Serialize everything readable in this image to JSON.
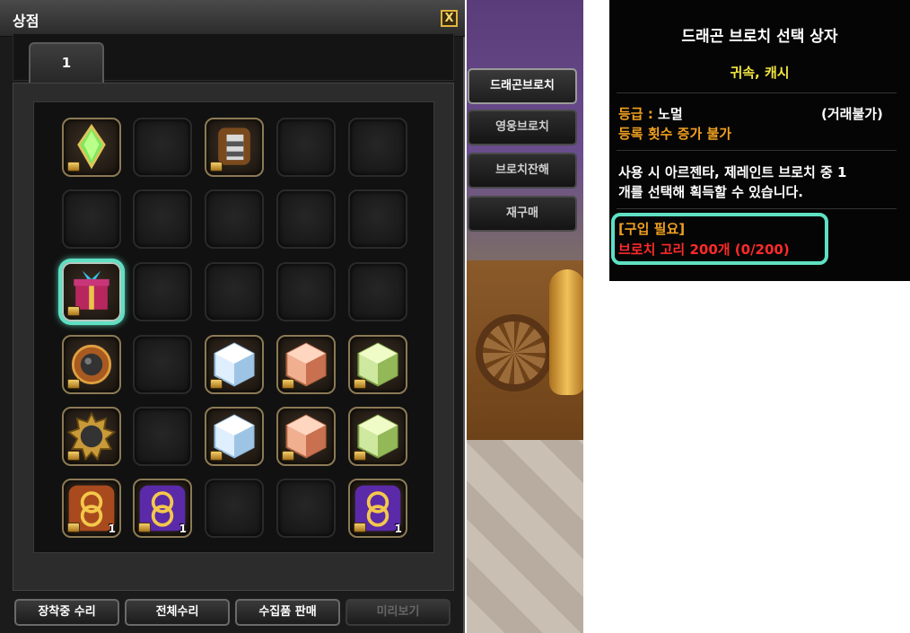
{
  "shop": {
    "title": "상점",
    "close_label": "X",
    "page_tab_label": "1",
    "grid": [
      [
        {
          "item": "emerald-gem"
        },
        {
          "item": null
        },
        {
          "item": "brooch-armor"
        },
        {
          "item": null
        },
        {
          "item": null
        }
      ],
      [
        {
          "item": null
        },
        {
          "item": null
        },
        {
          "item": null
        },
        {
          "item": null
        },
        {
          "item": null
        }
      ],
      [
        {
          "item": "gift-box",
          "selected": true
        },
        {
          "item": null
        },
        {
          "item": null
        },
        {
          "item": null
        },
        {
          "item": null
        }
      ],
      [
        {
          "item": "bomb-brooch"
        },
        {
          "item": null
        },
        {
          "item": "ice-cube"
        },
        {
          "item": "copper-cube"
        },
        {
          "item": "lime-cube"
        }
      ],
      [
        {
          "item": "spiked-bomb-brooch"
        },
        {
          "item": null
        },
        {
          "item": "ice-cube"
        },
        {
          "item": "copper-cube"
        },
        {
          "item": "lime-cube"
        }
      ],
      [
        {
          "item": "brooch-ring",
          "qty": "1"
        },
        {
          "item": "brooch-ring-purple",
          "qty": "1"
        },
        {
          "item": null
        },
        {
          "item": null
        },
        {
          "item": "brooch-ring-purple",
          "qty": "1"
        }
      ]
    ],
    "buttons": {
      "repair_equipped": "장착중 수리",
      "repair_all": "전체수리",
      "sell_collected": "수집품 판매",
      "preview": "미리보기"
    }
  },
  "categories": [
    "드래곤브로치",
    "영웅브로치",
    "브로치잔해",
    "재구매"
  ],
  "tooltip": {
    "title": "드래곤 브로치 선택 상자",
    "binding": "귀속, 캐시",
    "grade_label": "등급 : ",
    "grade_value": "노멀",
    "trade": "(거래불가)",
    "register": "등록 횟수 증가 불가",
    "desc_line1": "사용 시 아르젠타, 제레인트 브로치 중 1",
    "desc_line2": "개를 선택해 획득할 수 있습니다.",
    "req_label": "[구입 필요]",
    "req_value": "브로치 고리 200개 (0/200)"
  },
  "colors": {
    "highlight": "#5fe0c3",
    "tooltip_yellow": "#f2e640",
    "tooltip_orange": "#f0a020",
    "tooltip_red": "#ff2a2a"
  }
}
